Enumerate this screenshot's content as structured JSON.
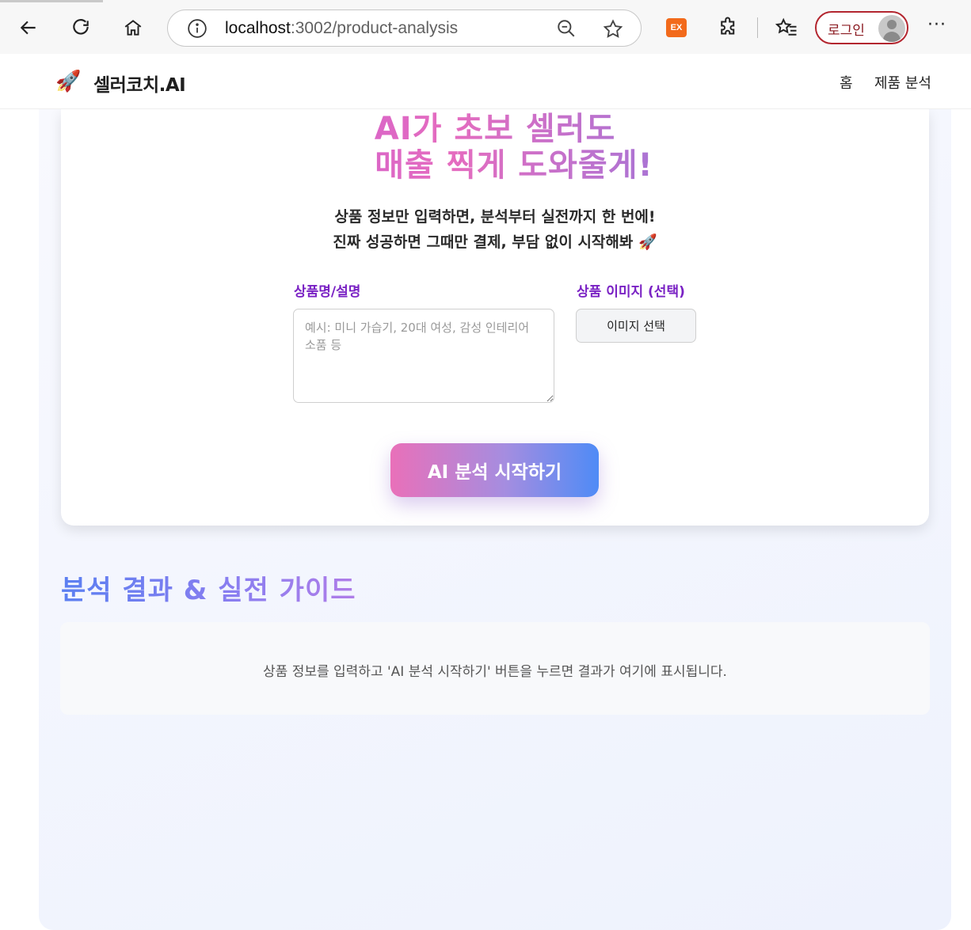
{
  "browser": {
    "url_host": "localhost",
    "url_path": ":3002/product-analysis",
    "extension_badge": "EX",
    "login_label": "로그인",
    "more_label": "···",
    "icons": [
      "back-icon",
      "reload-icon",
      "home-icon",
      "info-icon",
      "zoom-icon",
      "favorite-star-icon",
      "extension-icon",
      "puzzle-icon",
      "favorites-icon",
      "avatar-icon",
      "more-icon"
    ]
  },
  "header": {
    "logo_emoji": "🚀",
    "logo_text": "셀러코치.AI",
    "nav": {
      "home": "홈",
      "analysis": "제품 분석"
    }
  },
  "hero": {
    "title_line1": "AI가 초보 셀러도",
    "title_line2": "매출 찍게 도와줄게!",
    "subtitle_line1": "상품 정보만 입력하면, 분석부터 실전까지 한 번에!",
    "subtitle_line2": "진짜 성공하면 그때만 결제, 부담 없이 시작해봐 🚀"
  },
  "form": {
    "desc_label": "상품명/설명",
    "desc_value": "",
    "desc_placeholder": "예시: 미니 가습기, 20대 여성, 감성 인테리어 소품 등",
    "image_label": "상품 이미지 (선택)",
    "image_button": "이미지 선택",
    "submit": "AI 분석 시작하기"
  },
  "results": {
    "title": "분석 결과 & 실전 가이드",
    "placeholder": "상품 정보를 입력하고 'AI 분석 시작하기' 버튼을 누르면 결과가 여기에 표시됩니다."
  },
  "colors": {
    "accent_purple": "#7a22c4",
    "title_gradient": [
      "#b44fe4",
      "#e56cbf",
      "#5b7ff1"
    ],
    "button_gradient": [
      "#e970b9",
      "#a58de0",
      "#4f8bf6"
    ],
    "login_border": "#b3262f",
    "extension_orange": "#f26a1b"
  }
}
